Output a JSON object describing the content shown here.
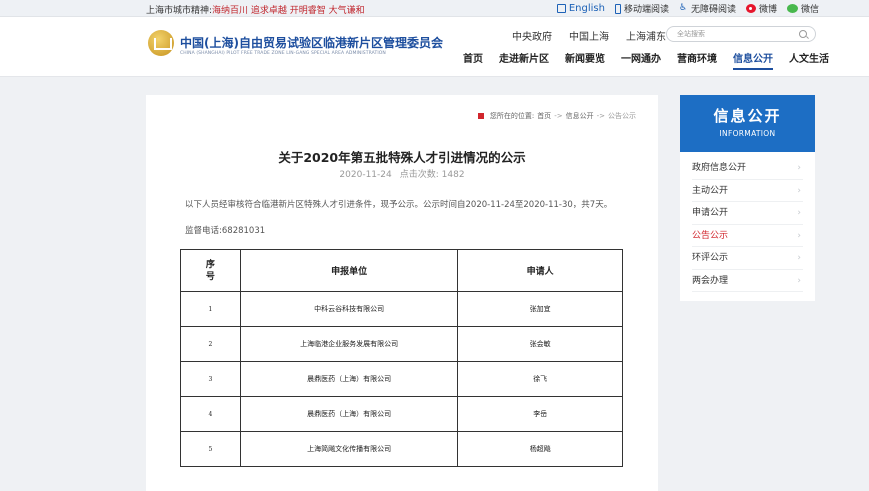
{
  "topbar": {
    "spirit_label": "上海市城市精神:",
    "spirit_motto": "海纳百川 追求卓越 开明睿智 大气谦和",
    "links": [
      {
        "label": "English",
        "icon": "english-icon"
      },
      {
        "label": "移动端阅读",
        "icon": "mobile-icon"
      },
      {
        "label": "无障碍阅读",
        "icon": "accessibility-icon"
      },
      {
        "label": "微博",
        "icon": "weibo-icon"
      },
      {
        "label": "微信",
        "icon": "wechat-icon"
      }
    ]
  },
  "header": {
    "org_title": "中国(上海)自由贸易试验区临港新片区管理委员会",
    "org_subtitle": "CHINA (SHANGHAI) PILOT FREE TRADE ZONE LIN-GANG SPECIAL AREA ADMINISTRATION",
    "external_links": [
      "中央政府",
      "中国上海",
      "上海浦东"
    ],
    "search_placeholder": "全站搜索",
    "nav": [
      "首页",
      "走进新片区",
      "新闻要览",
      "一网通办",
      "营商环境",
      "信息公开",
      "人文生活"
    ],
    "nav_active_index": 5
  },
  "breadcrumb": {
    "prefix": "您所在的位置:",
    "items": [
      "首页",
      "信息公开",
      "公告公示"
    ],
    "separator": "->"
  },
  "article": {
    "title": "关于2020年第五批特殊人才引进情况的公示",
    "date": "2020-11-24",
    "views_label": "点击次数:",
    "views": "1482",
    "intro": "以下人员经审核符合临港新片区特殊人才引进条件，现予公示。公示时间自2020-11-24至2020-11-30，共7天。",
    "phone_label": "监督电话:",
    "phone": "68281031"
  },
  "table": {
    "headers": {
      "no_line1": "序",
      "no_line2": "号",
      "unit": "申报单位",
      "applicant": "申请人"
    },
    "rows": [
      {
        "no": "1",
        "unit": "中科云谷科技有限公司",
        "applicant": "张加宜"
      },
      {
        "no": "2",
        "unit": "上海临港企业服务发展有限公司",
        "applicant": "张会敏"
      },
      {
        "no": "3",
        "unit": "晨鼎医药（上海）有限公司",
        "applicant": "徐飞"
      },
      {
        "no": "4",
        "unit": "晨鼎医药（上海）有限公司",
        "applicant": "李岳"
      },
      {
        "no": "5",
        "unit": "上海简飚文化传播有限公司",
        "applicant": "杨超飚"
      }
    ]
  },
  "sidebar": {
    "title": "信息公开",
    "subtitle": "INFORMATION",
    "items": [
      "政府信息公开",
      "主动公开",
      "申请公开",
      "公告公示",
      "环评公示",
      "两会办理"
    ],
    "active_index": 3,
    "accent_color": "#1d6ec4",
    "active_color": "#d1262d"
  }
}
